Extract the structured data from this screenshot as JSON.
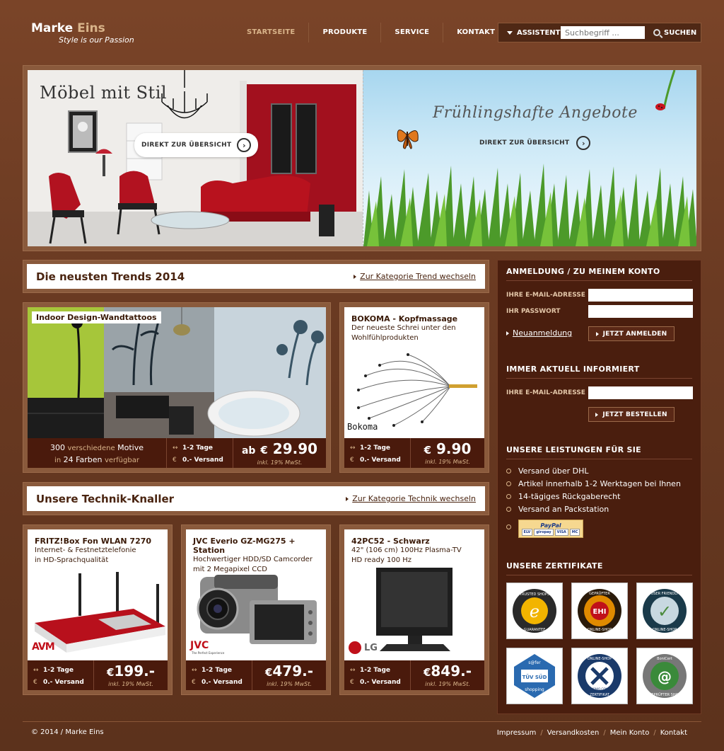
{
  "header": {
    "logo_main": "Marke",
    "logo_accent": "Eins",
    "tagline": "Style is our Passion",
    "nav": [
      "STARTSEITE",
      "PRODUKTE",
      "SERVICE",
      "KONTAKT"
    ],
    "assistant_label": "ASSISTENT",
    "search_placeholder": "Suchbegriff ...",
    "search_button": "SUCHEN"
  },
  "banner": {
    "left_title": "Möbel mit Stil",
    "left_button": "DIREKT ZUR ÜBERSICHT",
    "right_title": "Frühlingshafte Angebote",
    "right_button": "DIREKT ZUR ÜBERSICHT"
  },
  "trends": {
    "title": "Die neusten Trends 2014",
    "link": "Zur Kategorie Trend wechseln",
    "featured": {
      "label": "Indoor Design-Wandtattoos",
      "line1_num": "300",
      "line1_a": "verschiedene",
      "line1_b": "Motive",
      "line2_a": "in",
      "line2_num": "24 Farben",
      "line2_b": "verfügbar",
      "price_prefix": "ab",
      "currency": "€",
      "price": "29.90",
      "vat": "inkl. 19% MwSt."
    },
    "product": {
      "title": "BOKOMA - Kopfmassage",
      "desc1": "Der neueste Schrei unter den",
      "desc2": "Wohlfühlprodukten",
      "brand": "Bokoma",
      "currency": "€",
      "price": "9.90",
      "vat": "inkl. 19% MwSt."
    }
  },
  "delivery": {
    "days": "1-2 Tage",
    "shipping": "0.- Versand",
    "days_icon": "↔",
    "shipping_icon": "€"
  },
  "technik": {
    "title": "Unsere Technik-Knaller",
    "link": "Zur Kategorie Technik wechseln",
    "products": [
      {
        "title": "FRITZ!Box Fon WLAN 7270",
        "desc1": "Internet- & Festnetztelefonie",
        "desc2": "in HD-Sprachqualität",
        "brand": "AVM",
        "currency": "€",
        "price": "199.-",
        "vat": "inkl. 19% MwSt."
      },
      {
        "title": "JVC Everio GZ-MG275 + Station",
        "desc1": "Hochwertiger HDD/SD Camcorder",
        "desc2": "mit 2 Megapixel CCD",
        "brand": "JVC",
        "brand_sub": "The Perfect Experience",
        "currency": "€",
        "price": "479.-",
        "vat": "inkl. 19% MwSt."
      },
      {
        "title": "42PC52 - Schwarz",
        "desc1": "42\" (106 cm) 100Hz Plasma-TV",
        "desc2": "HD ready 100 Hz",
        "brand": "LG",
        "currency": "€",
        "price": "849.-",
        "vat": "inkl. 19% MwSt."
      }
    ]
  },
  "sidebar": {
    "login_title": "ANMELDUNG / ZU MEINEM KONTO",
    "email_label": "IHRE E-MAIL-ADRESSE",
    "password_label": "IHR PASSWORT",
    "register_link": "Neuanmeldung",
    "login_button": "JETZT ANMELDEN",
    "newsletter_title": "IMMER AKTUELL INFORMIERT",
    "newsletter_email_label": "IHRE E-MAIL-ADRESSE",
    "newsletter_button": "JETZT BESTELLEN",
    "services_title": "UNSERE LEISTUNGEN FÜR SIE",
    "services": [
      "Versand über DHL",
      "Artikel innerhalb 1-2 Werktagen bei Ihnen",
      "14-tägiges Rückgaberecht",
      "Versand an Packstation"
    ],
    "payment_brand": "PayPal",
    "payment_cards": [
      "ELV",
      "giropay",
      "VISA",
      "MC"
    ],
    "certs_title": "UNSERE ZERTIFIKATE",
    "certs": [
      {
        "name": "TRUSTED SHOPS",
        "sub": "GUARANTEE",
        "mark": "e",
        "color": "#f2b400"
      },
      {
        "name": "GEPRÜFTER",
        "sub": "ONLINE-SHOP",
        "mark": "EHI",
        "color": "#e08a00"
      },
      {
        "name": "USER FRIENDLY",
        "sub": "ONLINE-SHOP",
        "mark": "✓",
        "color": "#4a8a3a"
      },
      {
        "name": "s@fer",
        "sub": "shopping",
        "mark": "TÜV SÜD",
        "color": "#2a6ab0"
      },
      {
        "name": "ONLINE-SHOP",
        "sub": "ZERTIFIKAT",
        "mark": "XONIO.COM",
        "color": "#1a3a6a"
      },
      {
        "name": "BoniCert",
        "sub": "GEPRÜFTER SHOP",
        "mark": "@",
        "color": "#3a8a3a"
      }
    ]
  },
  "footer": {
    "copyright": "© 2014 / Marke Eins",
    "links": [
      "Impressum",
      "Versandkosten",
      "Mein Konto",
      "Kontakt"
    ]
  }
}
